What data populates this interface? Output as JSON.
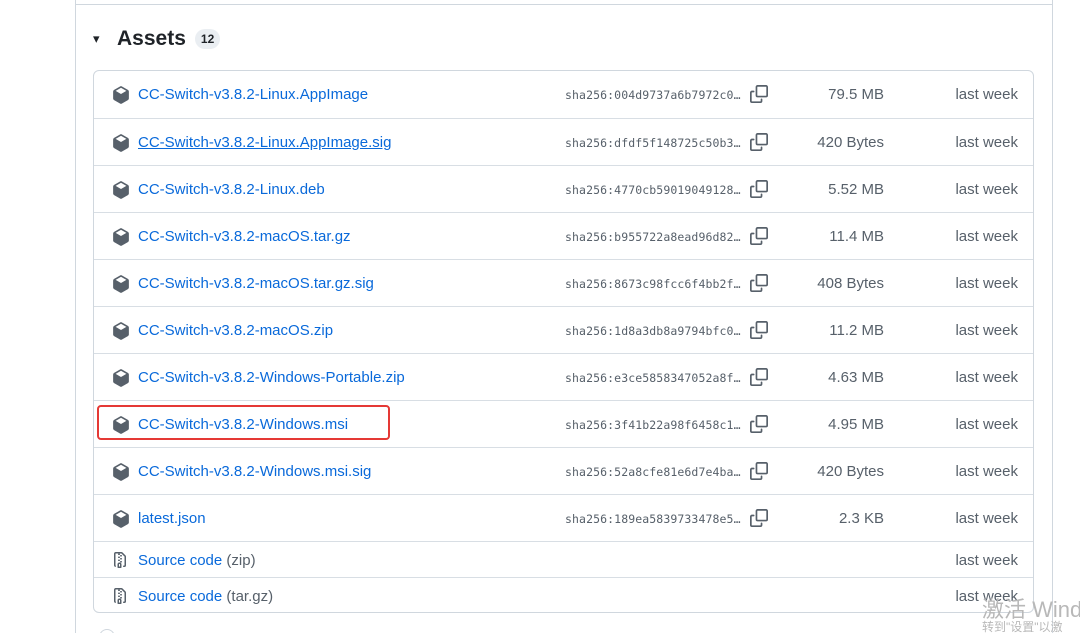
{
  "assets": {
    "title": "Assets",
    "count": "12",
    "caret": "▾",
    "rows": [
      {
        "name": "CC-Switch-v3.8.2-Linux.AppImage",
        "sha": "sha256:004d9737a6b7972c0…",
        "size": "79.5 MB",
        "date": "last week"
      },
      {
        "name": "CC-Switch-v3.8.2-Linux.AppImage.sig",
        "sha": "sha256:dfdf5f148725c50b3…",
        "size": "420 Bytes",
        "date": "last week"
      },
      {
        "name": "CC-Switch-v3.8.2-Linux.deb",
        "sha": "sha256:4770cb59019049128…",
        "size": "5.52 MB",
        "date": "last week"
      },
      {
        "name": "CC-Switch-v3.8.2-macOS.tar.gz",
        "sha": "sha256:b955722a8ead96d82…",
        "size": "11.4 MB",
        "date": "last week"
      },
      {
        "name": "CC-Switch-v3.8.2-macOS.tar.gz.sig",
        "sha": "sha256:8673c98fcc6f4bb2f…",
        "size": "408 Bytes",
        "date": "last week"
      },
      {
        "name": "CC-Switch-v3.8.2-macOS.zip",
        "sha": "sha256:1d8a3db8a9794bfc0…",
        "size": "11.2 MB",
        "date": "last week"
      },
      {
        "name": "CC-Switch-v3.8.2-Windows-Portable.zip",
        "sha": "sha256:e3ce5858347052a8f…",
        "size": "4.63 MB",
        "date": "last week"
      },
      {
        "name": "CC-Switch-v3.8.2-Windows.msi",
        "sha": "sha256:3f41b22a98f6458c1…",
        "size": "4.95 MB",
        "date": "last week"
      },
      {
        "name": "CC-Switch-v3.8.2-Windows.msi.sig",
        "sha": "sha256:52a8cfe81e6d7e4ba…",
        "size": "420 Bytes",
        "date": "last week"
      },
      {
        "name": "latest.json",
        "sha": "sha256:189ea5839733478e5…",
        "size": "2.3 KB",
        "date": "last week"
      }
    ],
    "source_rows": [
      {
        "label": "Source code",
        "suffix": "(zip)",
        "date": "last week"
      },
      {
        "label": "Source code",
        "suffix": "(tar.gz)",
        "date": "last week"
      }
    ]
  },
  "watermark": {
    "line1": "激活 Wind",
    "line2": "转到\"设置\"以激"
  },
  "colors": {
    "link": "#0969da",
    "muted": "#57606a",
    "border": "#d0d7de",
    "highlight": "#e53935"
  },
  "icons": {
    "asset": "package-icon",
    "copy": "copy-icon",
    "source": "file-zip-icon"
  }
}
